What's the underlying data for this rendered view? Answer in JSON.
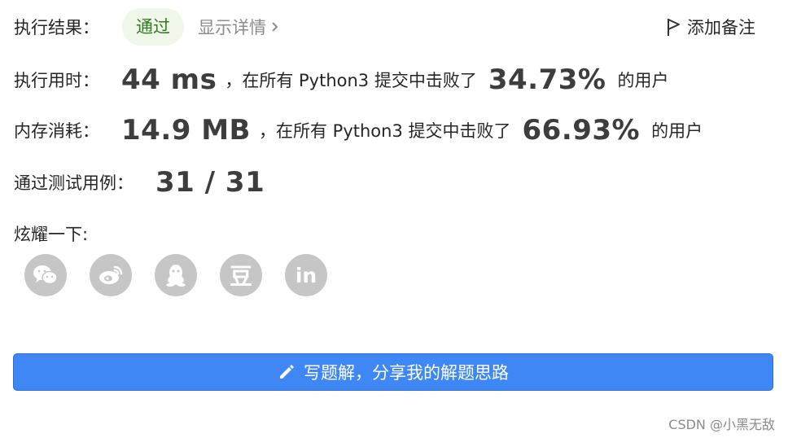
{
  "result": {
    "label": "执行结果：",
    "status": "通过",
    "details_link": "显示详情",
    "add_note": "添加备注"
  },
  "runtime": {
    "label": "执行用时：",
    "value": "44 ms",
    "prefix": "，在所有 Python3 提交中击败了",
    "percent": "34.73%",
    "suffix": "的用户"
  },
  "memory": {
    "label": "内存消耗：",
    "value": "14.9 MB",
    "prefix": "，在所有 Python3 提交中击败了",
    "percent": "66.93%",
    "suffix": "的用户"
  },
  "tests": {
    "label": "通过测试用例：",
    "value": "31 / 31"
  },
  "share": {
    "label": "炫耀一下:",
    "icons": [
      "wechat-icon",
      "weibo-icon",
      "qq-icon",
      "douban-icon",
      "linkedin-icon"
    ],
    "douban_glyph": "豆",
    "linkedin_glyph": "in"
  },
  "write_button": {
    "label": "写题解，分享我的解题思路"
  },
  "watermark": "CSDN @小黑无敌",
  "colors": {
    "accent": "#3f87f5",
    "success_bg": "#f1f6ea",
    "success_text": "#2d7d1f",
    "icon_bg": "#c6c6c6"
  }
}
